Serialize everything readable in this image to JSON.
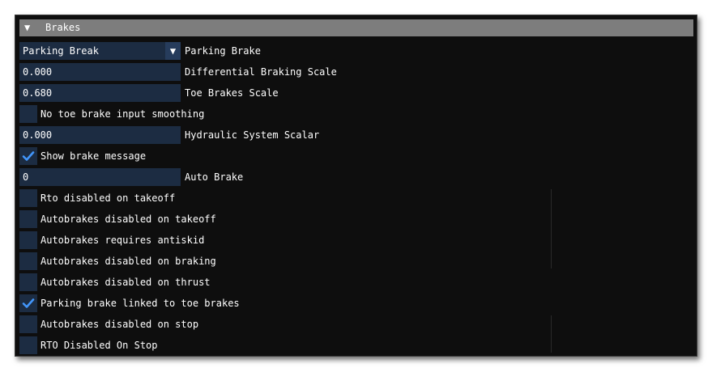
{
  "section": {
    "title": "Brakes",
    "expanded_glyph": "▼"
  },
  "colors": {
    "accent": "#4296fa",
    "field_bg": "#1c2c42",
    "header_bg": "#7d7d7d"
  },
  "parking_brake": {
    "selected": "Parking Break",
    "label": "Parking Brake",
    "dropdown_glyph": "▼"
  },
  "fields": {
    "differential_braking_scale": {
      "value": "0.000",
      "label": "Differential Braking Scale"
    },
    "toe_brakes_scale": {
      "value": "0.680",
      "label": "Toe Brakes Scale"
    },
    "hydraulic_system_scalar": {
      "value": "0.000",
      "label": "Hydraulic System Scalar"
    },
    "auto_brake": {
      "value": "0",
      "label": "Auto Brake"
    }
  },
  "checkboxes": {
    "no_toe_brake_input_smoothing": {
      "label": "No toe brake input smoothing",
      "checked": false
    },
    "show_brake_message": {
      "label": "Show brake message",
      "checked": true
    },
    "rto_disabled_on_takeoff": {
      "label": "Rto disabled on takeoff",
      "checked": false
    },
    "autobrakes_disabled_on_takeoff": {
      "label": "Autobrakes disabled on takeoff",
      "checked": false
    },
    "autobrakes_requires_antiskid": {
      "label": "Autobrakes requires antiskid",
      "checked": false
    },
    "autobrakes_disabled_on_braking": {
      "label": "Autobrakes disabled on braking",
      "checked": false
    },
    "autobrakes_disabled_on_thrust": {
      "label": "Autobrakes disabled on thrust",
      "checked": false
    },
    "parking_brake_linked_to_toe_brakes": {
      "label": "Parking brake linked to toe brakes",
      "checked": true
    },
    "autobrakes_disabled_on_stop": {
      "label": "Autobrakes disabled on stop",
      "checked": false
    },
    "rto_disabled_on_stop": {
      "label": "RTO Disabled On Stop",
      "checked": false
    }
  }
}
